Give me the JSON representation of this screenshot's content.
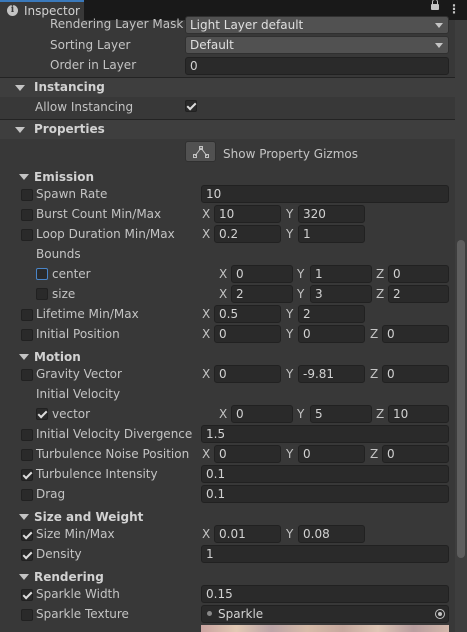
{
  "window": {
    "tab_title": "Inspector"
  },
  "renderer": {
    "rendering_layer_mask": {
      "label": "Rendering Layer Mask",
      "value": "Light Layer default"
    },
    "sorting_layer": {
      "label": "Sorting Layer",
      "value": "Default"
    },
    "order_in_layer": {
      "label": "Order in Layer",
      "value": "0"
    }
  },
  "instancing": {
    "title": "Instancing",
    "allow_label": "Allow Instancing",
    "allow_checked": true
  },
  "properties": {
    "title": "Properties",
    "gizmo_button_label": "Show Property Gizmos",
    "emission": {
      "title": "Emission",
      "spawn_rate": {
        "label": "Spawn Rate",
        "value": "10"
      },
      "burst_count": {
        "label": "Burst Count Min/Max",
        "x": "10",
        "y": "320"
      },
      "loop_duration": {
        "label": "Loop Duration Min/Max",
        "x": "0.2",
        "y": "1"
      },
      "bounds": {
        "label": "Bounds",
        "center": {
          "label": "center",
          "x": "0",
          "y": "1",
          "z": "0"
        },
        "size": {
          "label": "size",
          "x": "2",
          "y": "3",
          "z": "2"
        }
      },
      "lifetime": {
        "label": "Lifetime Min/Max",
        "x": "0.5",
        "y": "2"
      },
      "initial_position": {
        "label": "Initial Position",
        "x": "0",
        "y": "0",
        "z": "0"
      }
    },
    "motion": {
      "title": "Motion",
      "gravity": {
        "label": "Gravity Vector",
        "x": "0",
        "y": "-9.81",
        "z": "0"
      },
      "initial_velocity": {
        "label": "Initial Velocity",
        "vector": {
          "label": "vector",
          "x": "0",
          "y": "5",
          "z": "10"
        }
      },
      "velocity_divergence": {
        "label": "Initial Velocity Divergence",
        "value": "1.5"
      },
      "turbulence_noise": {
        "label": "Turbulence Noise Position",
        "x": "0",
        "y": "0",
        "z": "0"
      },
      "turbulence_intensity": {
        "label": "Turbulence Intensity",
        "value": "0.1"
      },
      "drag": {
        "label": "Drag",
        "value": "0.1"
      }
    },
    "size_weight": {
      "title": "Size and Weight",
      "size": {
        "label": "Size Min/Max",
        "x": "0.01",
        "y": "0.08"
      },
      "density": {
        "label": "Density",
        "value": "1"
      }
    },
    "rendering": {
      "title": "Rendering",
      "sparkle_width": {
        "label": "Sparkle Width",
        "value": "0.15"
      },
      "sparkle_texture": {
        "label": "Sparkle Texture",
        "value": "Sparkle"
      }
    }
  },
  "axes": {
    "x": "X",
    "y": "Y",
    "z": "Z"
  },
  "icons": [
    "info-icon",
    "lock-icon",
    "more-options-icon",
    "foldout-arrow-icon",
    "gizmo-icon",
    "checkmark-icon",
    "texture-icon",
    "object-picker-icon"
  ],
  "colors": {
    "background": "#383838",
    "field": "#2a2a2a",
    "tab_accent": "#3a79bb",
    "highlight_border": "#4a85c8"
  }
}
